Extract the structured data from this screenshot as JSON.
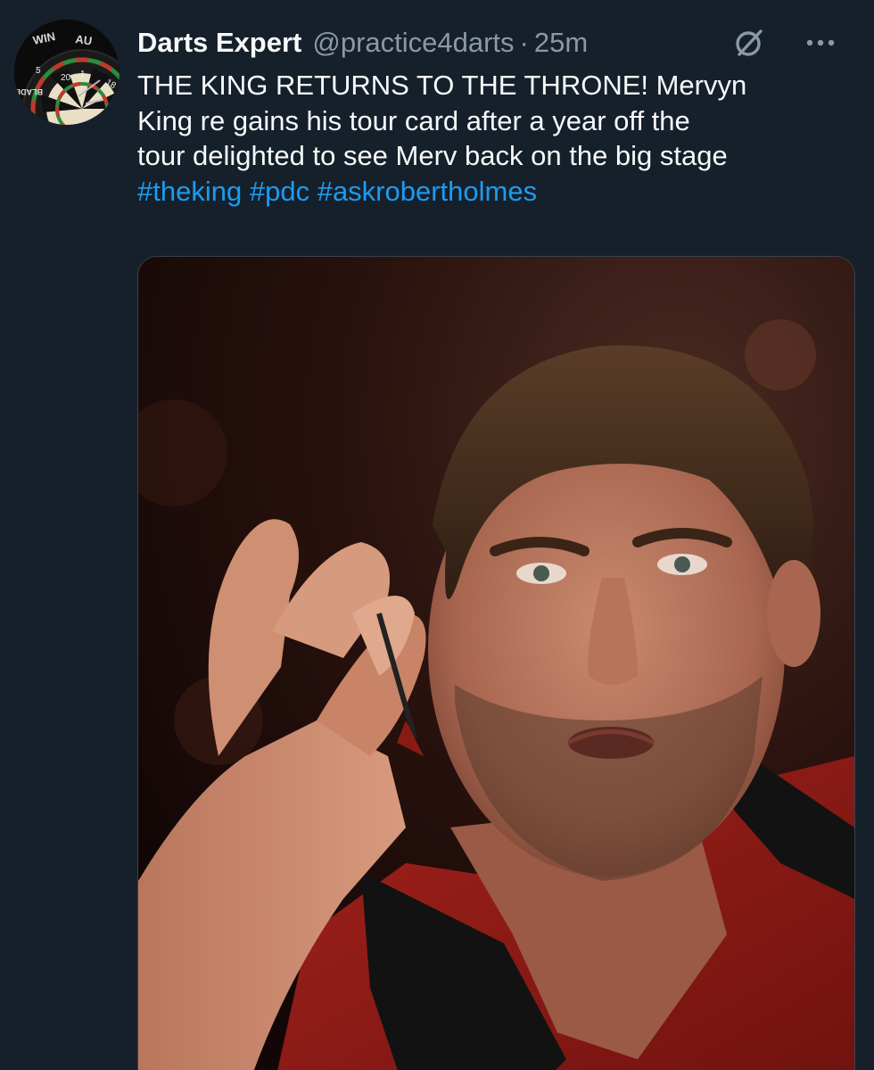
{
  "tweet": {
    "author": {
      "display_name": "Darts Expert",
      "handle": "@practice4darts",
      "separator": "·",
      "timestamp": "25m",
      "avatar_text_top": "WIN",
      "avatar_text_right": "AU",
      "avatar_board_numbers": [
        "5",
        "20",
        "1",
        "18"
      ],
      "avatar_side_text": "BLADE"
    },
    "icons": {
      "grok": "grok-icon",
      "more": "more-icon"
    },
    "text_lines": [
      "THE KING RETURNS TO THE THRONE! Mervyn",
      "King re gains his tour card after a year off the",
      "tour delighted to see Merv back on the big stage"
    ],
    "hashtags": [
      "#theking",
      "#pdc",
      "#askrobertholmes"
    ],
    "media": {
      "type": "photo",
      "icon": "photo-icon"
    }
  },
  "colors": {
    "background": "#15202b",
    "text": "#f7f9f9",
    "secondary_text": "#8b98a5",
    "link": "#1d9bf0",
    "border": "#38444d"
  }
}
